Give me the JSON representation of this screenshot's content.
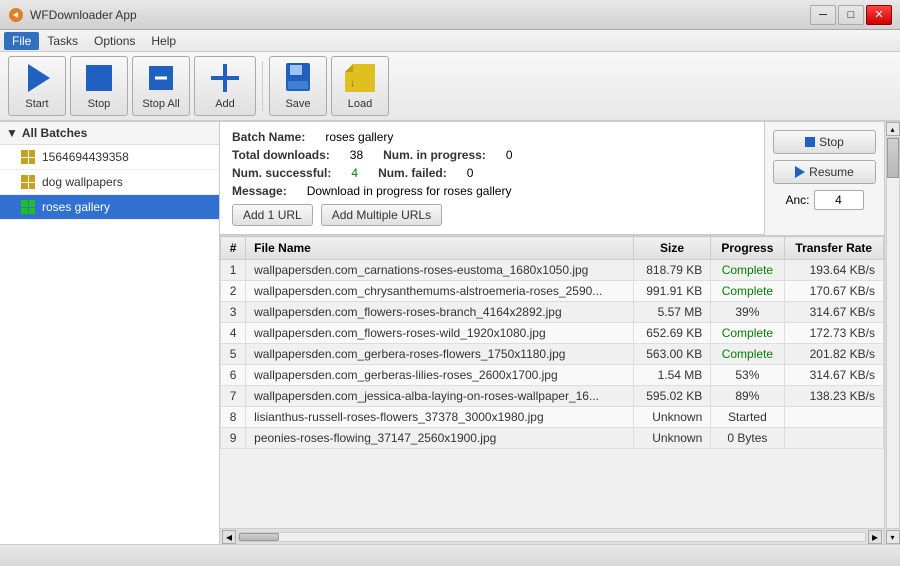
{
  "titleBar": {
    "title": "WFDownloader App",
    "controls": {
      "minimize": "─",
      "maximize": "□",
      "close": "✕"
    }
  },
  "menuBar": {
    "items": [
      {
        "id": "file",
        "label": "File",
        "active": true
      },
      {
        "id": "tasks",
        "label": "Tasks",
        "active": false
      },
      {
        "id": "options",
        "label": "Options",
        "active": false
      },
      {
        "id": "help",
        "label": "Help",
        "active": false
      }
    ]
  },
  "toolbar": {
    "start_label": "Start",
    "stop_label": "Stop",
    "stop_all_label": "Stop All",
    "add_label": "Add",
    "save_label": "Save",
    "load_label": "Load"
  },
  "sidebar": {
    "header": "All Batches",
    "items": [
      {
        "id": "batch1",
        "label": "1564694439358",
        "iconType": "orange",
        "active": false
      },
      {
        "id": "batch2",
        "label": "dog wallpapers",
        "iconType": "orange",
        "active": false
      },
      {
        "id": "batch3",
        "label": "roses gallery",
        "iconType": "green",
        "active": true
      }
    ]
  },
  "infoPanel": {
    "batchNameLabel": "Batch Name:",
    "batchName": "roses gallery",
    "totalDownloadsLabel": "Total downloads:",
    "totalDownloads": "38",
    "numInProgressLabel": "Num. in progress:",
    "numInProgress": "0",
    "numSuccessfulLabel": "Num. successful:",
    "numSuccessful": "4",
    "numFailedLabel": "Num. failed:",
    "numFailed": "0",
    "messageLabel": "Message:",
    "message": "Download in progress for roses gallery"
  },
  "buttons": {
    "add1URL": "Add 1 URL",
    "addMultipleURLs": "Add Multiple URLs"
  },
  "sidePanel": {
    "stopLabel": "Stop",
    "resumeLabel": "Resume",
    "ancLabel": "Anc:",
    "ancValue": "4"
  },
  "table": {
    "headers": [
      "#",
      "File Name",
      "Size",
      "Progress",
      "Transfer Rate"
    ],
    "rows": [
      {
        "num": "1",
        "filename": "wallpapersden.com_carnations-roses-eustoma_1680x1050.jpg",
        "size": "818.79 KB",
        "progress": "Complete",
        "rate": "193.64 KB/s",
        "progressClass": "complete"
      },
      {
        "num": "2",
        "filename": "wallpapersden.com_chrysanthemums-alstroemeria-roses_2590...",
        "size": "991.91 KB",
        "progress": "Complete",
        "rate": "170.67 KB/s",
        "progressClass": "complete"
      },
      {
        "num": "3",
        "filename": "wallpapersden.com_flowers-roses-branch_4164x2892.jpg",
        "size": "5.57 MB",
        "progress": "39%",
        "rate": "314.67 KB/s",
        "progressClass": "percent"
      },
      {
        "num": "4",
        "filename": "wallpapersden.com_flowers-roses-wild_1920x1080.jpg",
        "size": "652.69 KB",
        "progress": "Complete",
        "rate": "172.73 KB/s",
        "progressClass": "complete"
      },
      {
        "num": "5",
        "filename": "wallpapersden.com_gerbera-roses-flowers_1750x1180.jpg",
        "size": "563.00 KB",
        "progress": "Complete",
        "rate": "201.82 KB/s",
        "progressClass": "complete"
      },
      {
        "num": "6",
        "filename": "wallpapersden.com_gerberas-lilies-roses_2600x1700.jpg",
        "size": "1.54 MB",
        "progress": "53%",
        "rate": "314.67 KB/s",
        "progressClass": "percent"
      },
      {
        "num": "7",
        "filename": "wallpapersden.com_jessica-alba-laying-on-roses-wallpaper_16...",
        "size": "595.02 KB",
        "progress": "89%",
        "rate": "138.23 KB/s",
        "progressClass": "percent"
      },
      {
        "num": "8",
        "filename": "lisianthus-russell-roses-flowers_37378_3000x1980.jpg",
        "size": "Unknown",
        "progress": "Started",
        "rate": "",
        "progressClass": "started"
      },
      {
        "num": "9",
        "filename": "peonies-roses-flowing_37147_2560x1900.jpg",
        "size": "Unknown",
        "progress": "0 Bytes",
        "rate": "",
        "progressClass": "started"
      }
    ]
  },
  "statusBar": {
    "text": ""
  }
}
